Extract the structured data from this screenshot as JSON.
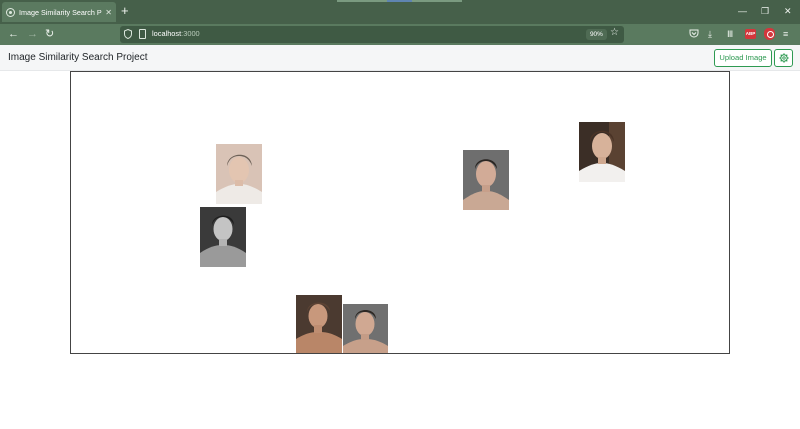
{
  "browser": {
    "tab": {
      "title": "Image Similarity Search Project",
      "favicon": "react-icon",
      "close_icon": "close-icon"
    },
    "new_tab_icon": "plus-icon",
    "window_controls": [
      "minimize-icon",
      "restore-icon",
      "close-icon"
    ],
    "nav": {
      "back_icon": "arrow-left-icon",
      "forward_icon": "arrow-right-icon",
      "reload_icon": "reload-icon"
    },
    "url": {
      "host": "localhost",
      "port": ":3000"
    },
    "zoom": "90%",
    "toolbar_icons": [
      "pocket-icon",
      "download-icon",
      "library-icon",
      "adblock-plus-icon",
      "ublock-icon",
      "menu-icon"
    ],
    "abp_label": "ABP"
  },
  "app": {
    "title": "Image Similarity Search Project",
    "upload_label": "Upload Image",
    "settings_icon": "gear-icon",
    "accent_color": "#2e9a52"
  },
  "canvas": {
    "images": [
      {
        "name": "portrait-1",
        "tone": "light-beige"
      },
      {
        "name": "portrait-2",
        "tone": "grayscale"
      },
      {
        "name": "portrait-3",
        "tone": "gray-studio"
      },
      {
        "name": "portrait-4",
        "tone": "warm-dark"
      },
      {
        "name": "portrait-5",
        "tone": "warm-tan"
      },
      {
        "name": "portrait-6",
        "tone": "gray-studio"
      }
    ]
  }
}
